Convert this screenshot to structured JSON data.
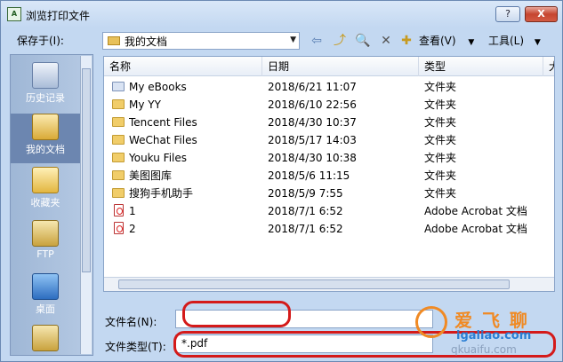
{
  "window": {
    "title": "浏览打印文件",
    "help_label": "?",
    "close_label": "X"
  },
  "toolbar": {
    "save_in_label": "保存于(I):",
    "current_folder": "我的文档",
    "view_label": "查看(V)",
    "tools_label": "工具(L)"
  },
  "places": [
    {
      "label": "历史记录",
      "icon": "history-icon"
    },
    {
      "label": "我的文档",
      "icon": "my-documents-icon"
    },
    {
      "label": "收藏夹",
      "icon": "favorites-icon"
    },
    {
      "label": "FTP",
      "icon": "ftp-icon"
    },
    {
      "label": "桌面",
      "icon": "desktop-icon"
    }
  ],
  "columns": [
    "名称",
    "日期",
    "类型",
    "大"
  ],
  "files": [
    {
      "name": "My eBooks",
      "date": "2018/6/21 11:07",
      "type": "文件夹",
      "icon": "ebooks-folder-icon"
    },
    {
      "name": "My YY",
      "date": "2018/6/10 22:56",
      "type": "文件夹",
      "icon": "folder-icon"
    },
    {
      "name": "Tencent Files",
      "date": "2018/4/30 10:37",
      "type": "文件夹",
      "icon": "folder-icon"
    },
    {
      "name": "WeChat Files",
      "date": "2018/5/17 14:03",
      "type": "文件夹",
      "icon": "folder-icon"
    },
    {
      "name": "Youku Files",
      "date": "2018/4/30 10:38",
      "type": "文件夹",
      "icon": "folder-icon"
    },
    {
      "name": "美图图库",
      "date": "2018/5/6 11:15",
      "type": "文件夹",
      "icon": "folder-icon"
    },
    {
      "name": "搜狗手机助手",
      "date": "2018/5/9 7:55",
      "type": "文件夹",
      "icon": "folder-icon"
    },
    {
      "name": "1",
      "date": "2018/7/1 6:52",
      "type": "Adobe Acrobat 文档",
      "icon": "pdf-file-icon"
    },
    {
      "name": "2",
      "date": "2018/7/1 6:52",
      "type": "Adobe Acrobat 文档",
      "icon": "pdf-file-icon"
    }
  ],
  "footer": {
    "filename_label": "文件名(N):",
    "filename_value": "",
    "filetype_label": "文件类型(T):",
    "filetype_value": "*.pdf"
  },
  "watermark": {
    "line1": "爱 飞 聊",
    "line2": "igaliao.com",
    "line3": "qkuaifu.com"
  }
}
